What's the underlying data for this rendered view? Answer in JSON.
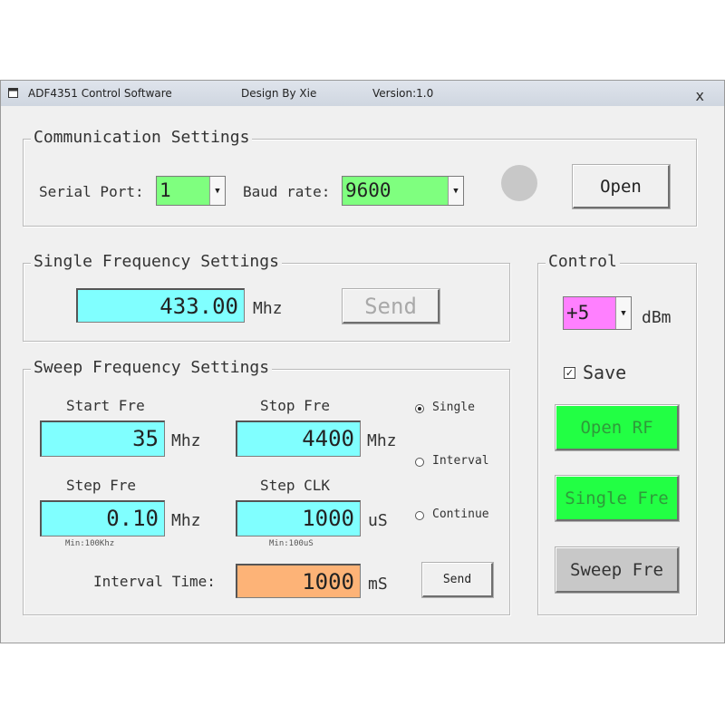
{
  "titlebar": {
    "app_title": "ADF4351 Control Software",
    "author": "Design By Xie",
    "version": "Version:1.0",
    "close_glyph": "x"
  },
  "communication": {
    "group_title": "Communication Settings",
    "serial_port_label": "Serial Port:",
    "serial_port_value": "1",
    "baud_rate_label": "Baud rate:",
    "baud_rate_value": "9600",
    "open_button": "Open",
    "status_led_color": "#c8c8c8"
  },
  "single_frequency": {
    "group_title": "Single Frequency Settings",
    "frequency_value": "433.00",
    "unit": "Mhz",
    "send_button": "Send"
  },
  "sweep_frequency": {
    "group_title": "Sweep Frequency Settings",
    "start_fre_label": "Start Fre",
    "start_fre_value": "35",
    "start_fre_unit": "Mhz",
    "stop_fre_label": "Stop Fre",
    "stop_fre_value": "4400",
    "stop_fre_unit": "Mhz",
    "step_fre_label": "Step Fre",
    "step_fre_value": "0.10",
    "step_fre_unit": "Mhz",
    "step_fre_hint": "Min:100Khz",
    "step_clk_label": "Step CLK",
    "step_clk_value": "1000",
    "step_clk_unit": "uS",
    "step_clk_hint": "Min:100uS",
    "interval_time_label": "Interval Time:",
    "interval_time_value": "1000",
    "interval_time_unit": "mS",
    "send_button": "Send",
    "modes": [
      {
        "label": "Single",
        "selected": true
      },
      {
        "label": "Interval",
        "selected": false
      },
      {
        "label": "Continue",
        "selected": false
      }
    ]
  },
  "control": {
    "group_title": "Control",
    "power_value": "+5",
    "power_unit": "dBm",
    "save_label": "Save",
    "save_checked": true,
    "open_rf_button": "Open RF",
    "single_fre_button": "Single Fre",
    "sweep_fre_button": "Sweep Fre"
  },
  "colors": {
    "green_field": "#7fff7f",
    "cyan_field": "#80ffff",
    "orange_field": "#fdb377",
    "magenta_field": "#ff80ff",
    "green_button": "#22ff44"
  }
}
